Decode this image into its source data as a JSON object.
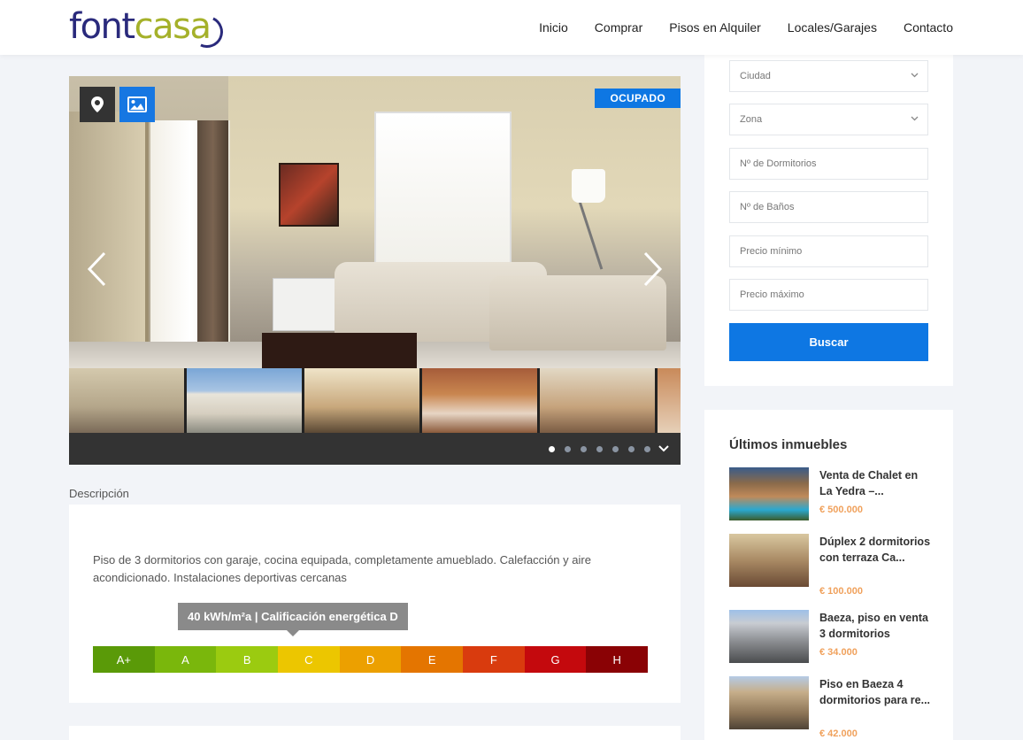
{
  "brand": {
    "logo_part1": "font",
    "logo_part2": "cas",
    "logo_part3": "a"
  },
  "nav": {
    "items": [
      {
        "label": "Inicio"
      },
      {
        "label": "Comprar"
      },
      {
        "label": "Pisos en Alquiler"
      },
      {
        "label": "Locales/Garajes"
      },
      {
        "label": "Contacto"
      }
    ]
  },
  "gallery": {
    "status": "OCUPADO",
    "map_icon": "map-pin-icon",
    "photo_icon": "image-icon",
    "dot_count": 7,
    "active_dot": 0
  },
  "description": {
    "heading": "Descripción",
    "text": "Piso de 3 dormitorios con garaje, cocina equipada, completamente amueblado. Calefacción y aire acondicionado. Instalaciones deportivas cercanas",
    "energy_label": "40 kWh/m²a | Calificación energética D",
    "energy_classes": [
      {
        "label": "A+",
        "color": "#5a9a08"
      },
      {
        "label": "A",
        "color": "#7ab70c"
      },
      {
        "label": "B",
        "color": "#9bcb10"
      },
      {
        "label": "C",
        "color": "#ecc600"
      },
      {
        "label": "D",
        "color": "#eca000"
      },
      {
        "label": "E",
        "color": "#e47500"
      },
      {
        "label": "F",
        "color": "#d93b0e"
      },
      {
        "label": "G",
        "color": "#c4090d"
      },
      {
        "label": "H",
        "color": "#8a0205"
      }
    ]
  },
  "search": {
    "city_placeholder": "Ciudad",
    "zone_placeholder": "Zona",
    "bedrooms_placeholder": "Nº de Dormitorios",
    "bathrooms_placeholder": "Nº de Baños",
    "min_price_placeholder": "Precio mínimo",
    "max_price_placeholder": "Precio máximo",
    "submit_label": "Buscar"
  },
  "latest": {
    "title": "Últimos inmuebles",
    "items": [
      {
        "name": "Venta de Chalet en La Yedra –...",
        "price": "€ 500.000"
      },
      {
        "name": "Dúplex 2 dormitorios con terraza Ca...",
        "price": "€ 100.000"
      },
      {
        "name": "Baeza, piso en venta 3 dormitorios",
        "price": "€ 34.000"
      },
      {
        "name": "Piso en Baeza 4 dormitorios para re...",
        "price": "€ 42.000"
      }
    ]
  },
  "colors": {
    "accent": "#0e77e3",
    "price": "#f0a15c",
    "logo_blue": "#2a2a7c",
    "logo_green": "#a5b12a"
  }
}
